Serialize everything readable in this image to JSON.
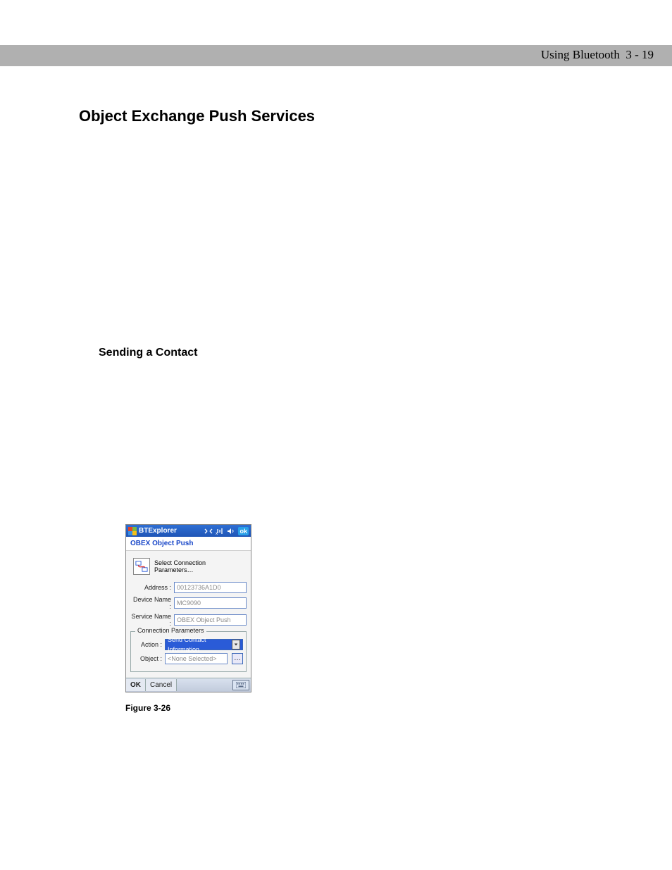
{
  "header": {
    "section": "Using Bluetooth",
    "page": "3 - 19"
  },
  "headings": {
    "h1": "Object Exchange Push Services",
    "h2": "Sending a Contact"
  },
  "caption": "Figure 3-26",
  "device": {
    "titlebar": {
      "app_title": "BTExplorer",
      "ok_label": "ok"
    },
    "subtitle": "OBEX Object Push",
    "instruction": "Select Connection Parameters…",
    "fields": {
      "address_label": "Address :",
      "address_value": "00123736A1D0",
      "device_name_label": "Device Name :",
      "device_name_value": "MC9090",
      "service_name_label": "Service Name :",
      "service_name_value": "OBEX Object Push"
    },
    "group": {
      "legend": "Connection Parameters",
      "action_label": "Action :",
      "action_value": "Send Contact Information",
      "object_label": "Object :",
      "object_value": "<None Selected>"
    },
    "footer": {
      "ok": "OK",
      "cancel": "Cancel"
    }
  }
}
